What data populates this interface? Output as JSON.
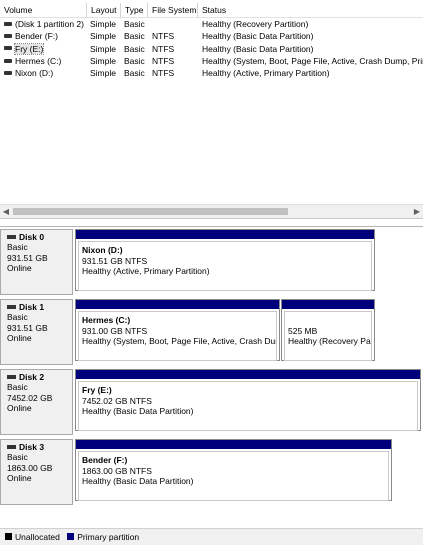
{
  "volume_list": {
    "columns": [
      "Volume",
      "Layout",
      "Type",
      "File System",
      "Status"
    ],
    "rows": [
      {
        "volume": "(Disk 1 partition 2)",
        "layout": "Simple",
        "type": "Basic",
        "fs": "",
        "status": "Healthy (Recovery Partition)"
      },
      {
        "volume": "Bender (F:)",
        "layout": "Simple",
        "type": "Basic",
        "fs": "NTFS",
        "status": "Healthy (Basic Data Partition)"
      },
      {
        "volume": "Fry (E:)",
        "layout": "Simple",
        "type": "Basic",
        "fs": "NTFS",
        "status": "Healthy (Basic Data Partition)"
      },
      {
        "volume": "Hermes (C:)",
        "layout": "Simple",
        "type": "Basic",
        "fs": "NTFS",
        "status": "Healthy (System, Boot, Page File, Active, Crash Dump, Prim"
      },
      {
        "volume": "Nixon (D:)",
        "layout": "Simple",
        "type": "Basic",
        "fs": "NTFS",
        "status": "Healthy (Active, Primary Partition)"
      }
    ]
  },
  "disks": [
    {
      "name": "Disk 0",
      "type": "Basic",
      "size": "931.51 GB",
      "state": "Online",
      "partitions": [
        {
          "name": "Nixon  (D:)",
          "size": "931.51 GB NTFS",
          "status": "Healthy (Active, Primary Partition)"
        }
      ]
    },
    {
      "name": "Disk 1",
      "type": "Basic",
      "size": "931.51 GB",
      "state": "Online",
      "partitions": [
        {
          "name": "Hermes  (C:)",
          "size": "931.00 GB NTFS",
          "status": "Healthy (System, Boot, Page File, Active, Crash Dum"
        },
        {
          "name": "",
          "size": "525 MB",
          "status": "Healthy (Recovery Par"
        }
      ]
    },
    {
      "name": "Disk 2",
      "type": "Basic",
      "size": "7452.02 GB",
      "state": "Online",
      "partitions": [
        {
          "name": "Fry  (E:)",
          "size": "7452.02 GB NTFS",
          "status": "Healthy (Basic Data Partition)"
        }
      ]
    },
    {
      "name": "Disk 3",
      "type": "Basic",
      "size": "1863.00 GB",
      "state": "Online",
      "partitions": [
        {
          "name": "Bender  (F:)",
          "size": "1863.00 GB NTFS",
          "status": "Healthy (Basic Data Partition)"
        }
      ]
    }
  ],
  "legend": {
    "unallocated": "Unallocated",
    "primary": "Primary partition"
  },
  "colors": {
    "primary_partition": "#00007c",
    "unallocated": "#000000"
  },
  "icons": {
    "volume": "disk-icon",
    "scroll_left": "scroll-left-arrow",
    "scroll_right": "scroll-right-arrow"
  }
}
